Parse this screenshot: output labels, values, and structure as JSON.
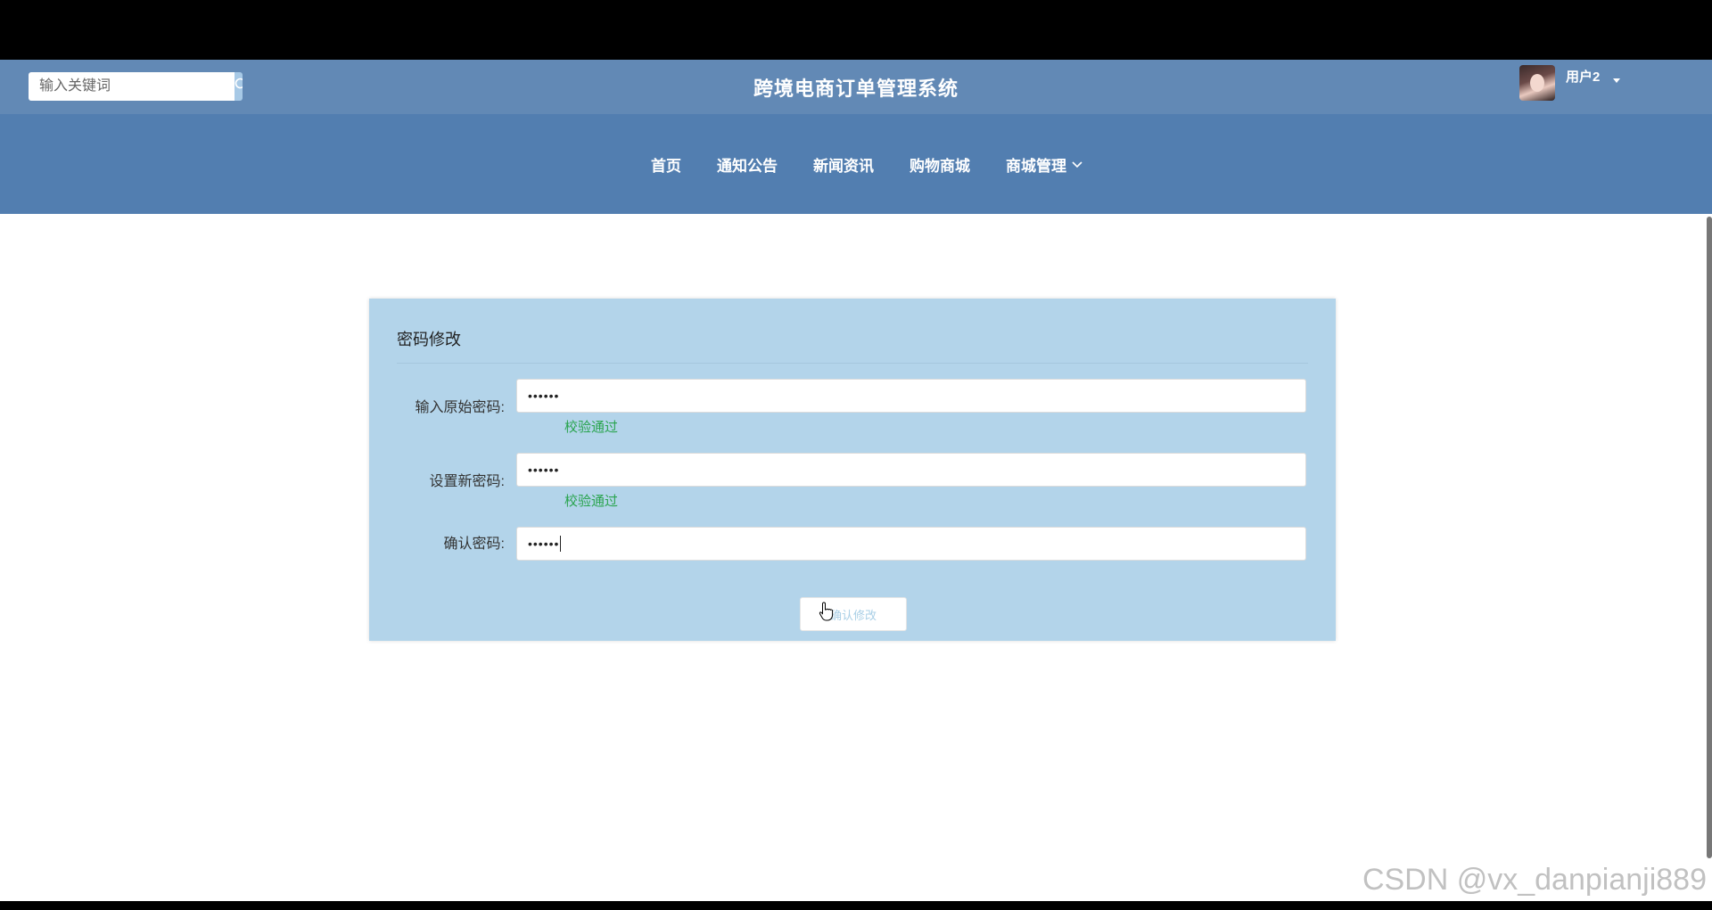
{
  "header": {
    "search_placeholder": "输入关键词",
    "site_title": "跨境电商订单管理系统",
    "username": "用户2"
  },
  "nav": {
    "items": [
      {
        "label": "首页"
      },
      {
        "label": "通知公告"
      },
      {
        "label": "新闻资讯"
      },
      {
        "label": "购物商城"
      },
      {
        "label": "商城管理",
        "has_dropdown": true
      }
    ]
  },
  "password_form": {
    "title": "密码修改",
    "fields": [
      {
        "label": "输入原始密码:",
        "value": "••••••",
        "validation": "校验通过"
      },
      {
        "label": "设置新密码:",
        "value": "••••••",
        "validation": "校验通过"
      },
      {
        "label": "确认密码:",
        "value": "••••••",
        "validation": ""
      }
    ],
    "submit_label": "确认修改"
  },
  "watermark": "CSDN @vx_danpianji889",
  "colors": {
    "topbar": "#6289b5",
    "navbar": "#527eb0",
    "panel": "#b3d4ea",
    "valid": "#2aa44f"
  }
}
